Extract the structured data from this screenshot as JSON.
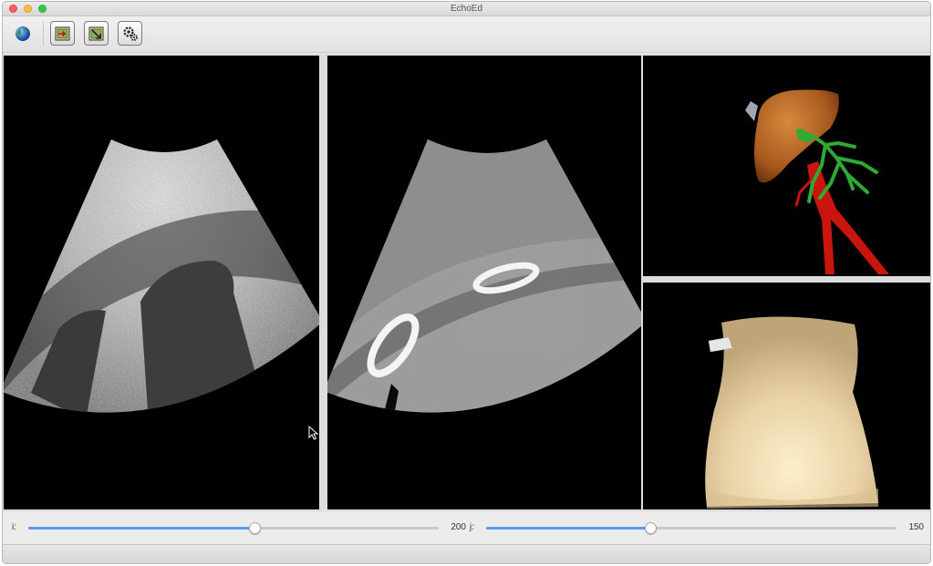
{
  "window": {
    "title": "EchoEd"
  },
  "toolbar": {
    "icons": [
      "globe-icon",
      "open-file-icon",
      "export-icon",
      "settings-icon"
    ]
  },
  "views": {
    "ultrasound": "ultrasound-image",
    "ct": "ct-image",
    "vessels": "liver-vessels-3d",
    "body": "torso-3d-model"
  },
  "sliders": {
    "i": {
      "label": "i:",
      "value": "200",
      "level_fraction": 0.55
    },
    "j": {
      "label": "j:",
      "value": "150",
      "level_fraction": 0.4
    }
  },
  "colors": {
    "accent": "#5b9cf2",
    "liver": "#a85a1e",
    "artery": "#c8160e",
    "portal_vein": "#2fa834",
    "skin": "#e9d2a6"
  }
}
